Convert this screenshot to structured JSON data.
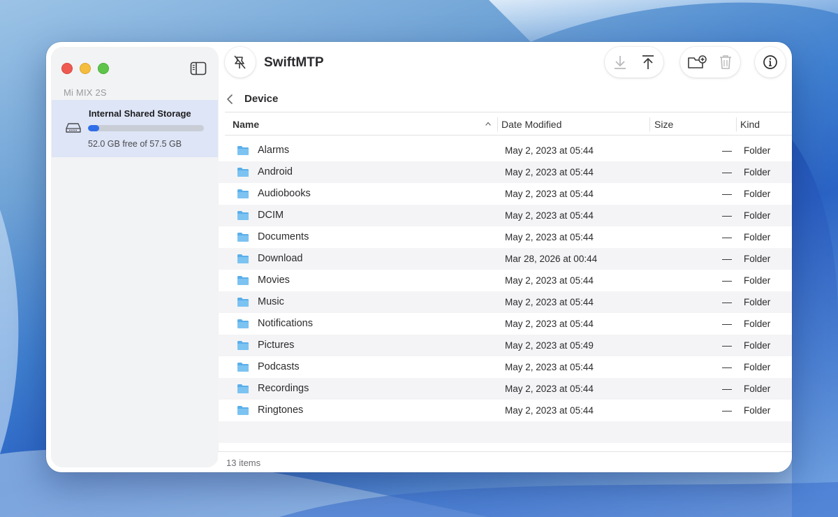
{
  "app": {
    "title": "SwiftMTP",
    "device_name": "Mi MIX 2S",
    "location": "Device"
  },
  "storage": {
    "name": "Internal Shared Storage",
    "summary": "52.0 GB free of 57.5 GB",
    "used_fraction": 0.096
  },
  "toolbar": {
    "icons": [
      "sidebar-toggle-icon",
      "pin-icon",
      "download-icon",
      "upload-icon",
      "new-folder-icon",
      "trash-icon",
      "info-icon"
    ]
  },
  "table": {
    "columns": {
      "name": "Name",
      "date": "Date Modified",
      "size": "Size",
      "kind": "Kind"
    },
    "sort": "name-ascending",
    "rows": [
      {
        "name": "Alarms",
        "date": "May 2, 2023 at 05:44",
        "size": "—",
        "kind": "Folder"
      },
      {
        "name": "Android",
        "date": "May 2, 2023 at 05:44",
        "size": "—",
        "kind": "Folder"
      },
      {
        "name": "Audiobooks",
        "date": "May 2, 2023 at 05:44",
        "size": "—",
        "kind": "Folder"
      },
      {
        "name": "DCIM",
        "date": "May 2, 2023 at 05:44",
        "size": "—",
        "kind": "Folder"
      },
      {
        "name": "Documents",
        "date": "May 2, 2023 at 05:44",
        "size": "—",
        "kind": "Folder"
      },
      {
        "name": "Download",
        "date": "Mar 28, 2026 at 00:44",
        "size": "—",
        "kind": "Folder"
      },
      {
        "name": "Movies",
        "date": "May 2, 2023 at 05:44",
        "size": "—",
        "kind": "Folder"
      },
      {
        "name": "Music",
        "date": "May 2, 2023 at 05:44",
        "size": "—",
        "kind": "Folder"
      },
      {
        "name": "Notifications",
        "date": "May 2, 2023 at 05:44",
        "size": "—",
        "kind": "Folder"
      },
      {
        "name": "Pictures",
        "date": "May 2, 2023 at 05:49",
        "size": "—",
        "kind": "Folder"
      },
      {
        "name": "Podcasts",
        "date": "May 2, 2023 at 05:44",
        "size": "—",
        "kind": "Folder"
      },
      {
        "name": "Recordings",
        "date": "May 2, 2023 at 05:44",
        "size": "—",
        "kind": "Folder"
      },
      {
        "name": "Ringtones",
        "date": "May 2, 2023 at 05:44",
        "size": "—",
        "kind": "Folder"
      }
    ]
  },
  "status": {
    "item_count": "13 items"
  },
  "colors": {
    "accent": "#2f6ee8",
    "folder": "#5aaeea",
    "selection": "#dde5f6",
    "close": "#ee5a52",
    "minimize": "#f4bd3d",
    "zoom": "#5ec54a"
  }
}
